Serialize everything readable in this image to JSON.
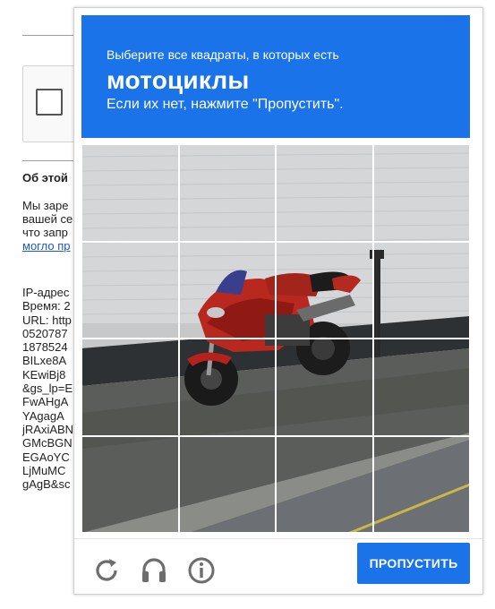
{
  "background_page": {
    "about_heading": "Об этой",
    "paragraph_lines": [
      "Мы заре",
      "вашей се",
      "что запр"
    ],
    "link_text": "могло пр",
    "info_lines": [
      "IP-адрес",
      "Время: 2",
      "URL: http",
      "0520787",
      "1878524",
      "BILxe8A",
      "KEwiBj8",
      "&gs_lp=E",
      "FwAHgA",
      "YAgagA",
      "jRAxiABN",
      "GMcBGN",
      "EGAoYC",
      "LjMuMC",
      "gAgB&sc"
    ]
  },
  "challenge": {
    "prompt_line1": "Выберите все квадраты, в которых есть",
    "target": "мотоциклы",
    "prompt_line2": "Если их нет, нажмите \"Пропустить\".",
    "tiles": [
      "1",
      "2",
      "3",
      "4",
      "5",
      "6",
      "7",
      "8",
      "9",
      "10",
      "11",
      "12",
      "13",
      "14",
      "15",
      "16"
    ],
    "colors": {
      "accent": "#1a73e8",
      "icon": "#6d6d6d"
    }
  },
  "footer": {
    "icons": [
      "reload-icon",
      "audio-icon",
      "info-icon"
    ],
    "skip_label": "ПРОПУСТИТЬ"
  }
}
